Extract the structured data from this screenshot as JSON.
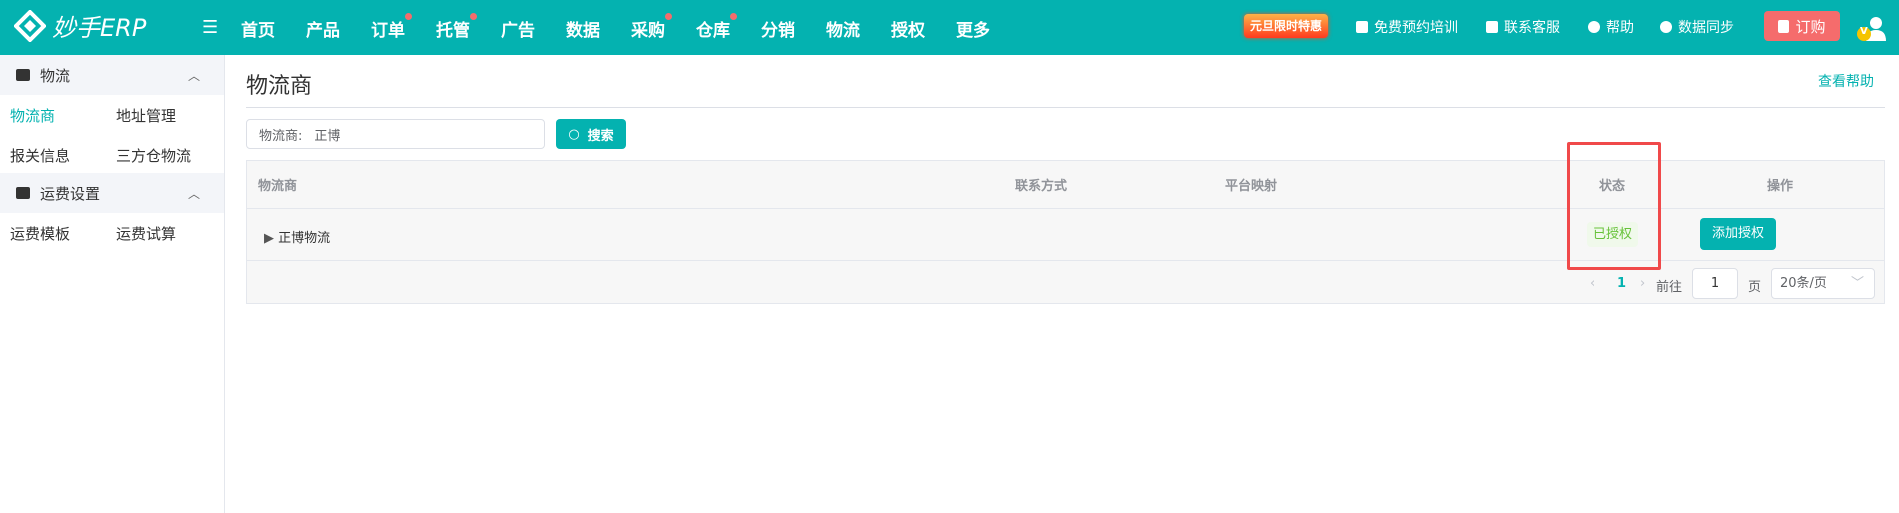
{
  "header": {
    "logo": "妙手ERP",
    "nav": [
      {
        "label": "首页",
        "dot": false
      },
      {
        "label": "产品",
        "dot": false
      },
      {
        "label": "订单",
        "dot": true
      },
      {
        "label": "托管",
        "dot": true
      },
      {
        "label": "广告",
        "dot": false
      },
      {
        "label": "数据",
        "dot": false
      },
      {
        "label": "采购",
        "dot": true
      },
      {
        "label": "仓库",
        "dot": true
      },
      {
        "label": "分销",
        "dot": false
      },
      {
        "label": "物流",
        "dot": false
      },
      {
        "label": "授权",
        "dot": false
      },
      {
        "label": "更多",
        "dot": false
      }
    ],
    "promo": "元旦限时特惠",
    "training": "免费预约培训",
    "service": "联系客服",
    "help": "帮助",
    "sync": "数据同步",
    "order": "订购",
    "avatar_badge": "V"
  },
  "sidebar": {
    "groups": [
      {
        "label": "物流",
        "items": [
          "物流商",
          "地址管理",
          "报关信息",
          "三方仓物流"
        ]
      },
      {
        "label": "运费设置",
        "items": [
          "运费模板",
          "运费试算"
        ]
      }
    ]
  },
  "main": {
    "title": "物流商",
    "help_link": "查看帮助",
    "search": {
      "label": "物流商:",
      "value": "正博",
      "button": "搜索"
    },
    "table": {
      "columns": [
        "物流商",
        "联系方式",
        "平台映射",
        "状态",
        "操作"
      ],
      "rows": [
        {
          "name": "正博物流",
          "status": "已授权",
          "action": "添加授权"
        }
      ]
    },
    "pagination": {
      "current": "1",
      "goto_label": "前往",
      "goto_value": "1",
      "page_suffix": "页",
      "page_size": "20条/页"
    }
  },
  "colors": {
    "brand": "#04b2b0",
    "highlight": "#f0494a",
    "success": "#67c23a"
  }
}
